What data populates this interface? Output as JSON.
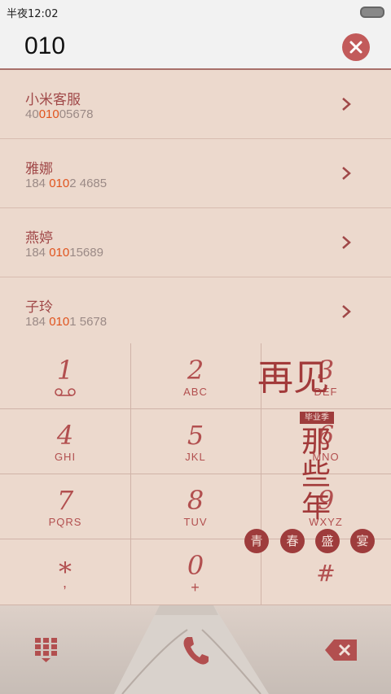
{
  "status_bar": {
    "time": "半夜12:02"
  },
  "search": {
    "value": "010"
  },
  "contacts": [
    {
      "name": "小米客服",
      "number_before": "40",
      "number_match": "010",
      "number_after": "05678"
    },
    {
      "name": "雅娜",
      "number_before": "184 ",
      "number_match": "010",
      "number_after": "2 4685"
    },
    {
      "name": "燕婷",
      "number_before": "184 ",
      "number_match": "010",
      "number_after": "15689"
    },
    {
      "name": "子玲",
      "number_before": "184 ",
      "number_match": "010",
      "number_after": "1 5678"
    }
  ],
  "dialpad": [
    {
      "digit": "1",
      "letters": ""
    },
    {
      "digit": "2",
      "letters": "ABC"
    },
    {
      "digit": "3",
      "letters": "DEF"
    },
    {
      "digit": "4",
      "letters": "GHI"
    },
    {
      "digit": "5",
      "letters": "JKL"
    },
    {
      "digit": "6",
      "letters": "MNO"
    },
    {
      "digit": "7",
      "letters": "PQRS"
    },
    {
      "digit": "8",
      "letters": "TUV"
    },
    {
      "digit": "9",
      "letters": "WXYZ"
    },
    {
      "digit": "*",
      "letters": ","
    },
    {
      "digit": "0",
      "letters": "+"
    },
    {
      "digit": "#",
      "letters": ""
    }
  ],
  "artwork": {
    "line1": "再见",
    "line2": "那些年",
    "tag": "毕业季",
    "seals": [
      "青",
      "春",
      "盛",
      "宴"
    ]
  },
  "icons": {
    "voicemail": "voicemail-icon",
    "clear": "close-icon",
    "chevron": "chevron-right-icon",
    "keypad": "keypad-icon",
    "call": "phone-icon",
    "delete": "backspace-icon"
  },
  "colors": {
    "accent": "#b24f4f",
    "match_highlight": "#e0541e",
    "background": "#ecd9cd"
  }
}
